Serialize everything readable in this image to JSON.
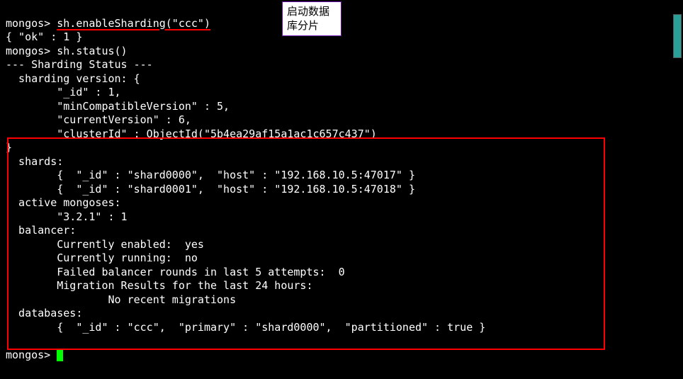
{
  "prompt": "mongos>",
  "cmd1": "sh.enableSharding(\"ccc\")",
  "out1": "{ \"ok\" : 1 }",
  "cmd2": "sh.status()",
  "status_header": "--- Sharding Status ---",
  "version_header": "  sharding version: {",
  "version_id": "        \"_id\" : 1,",
  "version_mincompat": "        \"minCompatibleVersion\" : 5,",
  "version_current": "        \"currentVersion\" : 6,",
  "version_cluster": "        \"clusterId\" : ObjectId(\"5b4ea29af15a1ac1c657c437\")",
  "brace_close": "}",
  "shards_header": "  shards:",
  "shard0": "        {  \"_id\" : \"shard0000\",  \"host\" : \"192.168.10.5:47017\" }",
  "shard1": "        {  \"_id\" : \"shard0001\",  \"host\" : \"192.168.10.5:47018\" }",
  "active_mongoses": "  active mongoses:",
  "mongoses_ver": "        \"3.2.1\" : 1",
  "balancer_header": "  balancer:",
  "balancer_enabled": "        Currently enabled:  yes",
  "balancer_running": "        Currently running:  no",
  "balancer_failed": "        Failed balancer rounds in last 5 attempts:  0",
  "balancer_mig": "        Migration Results for the last 24 hours:",
  "balancer_nomig": "                No recent migrations",
  "databases_header": "  databases:",
  "db0": "        {  \"_id\" : \"ccc\",  \"primary\" : \"shard0000\",  \"partitioned\" : true }",
  "annotation": "启动数据库分片"
}
